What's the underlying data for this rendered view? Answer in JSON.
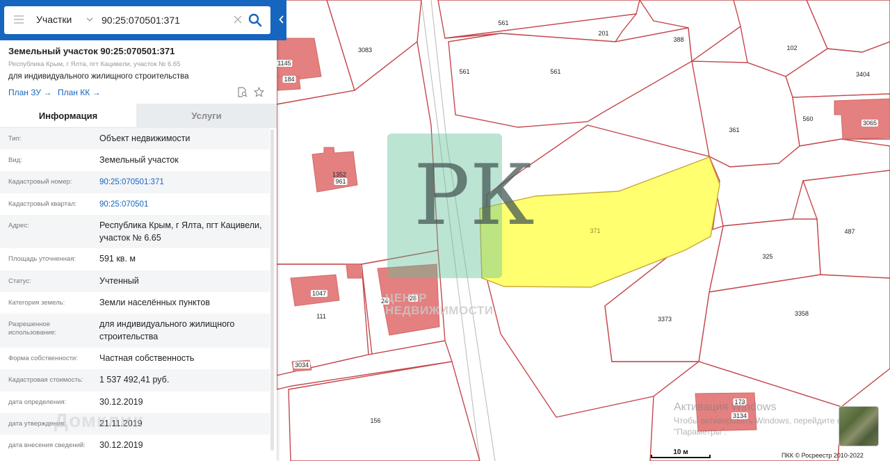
{
  "search": {
    "type_label": "Участки",
    "query": "90:25:070501:371"
  },
  "parcel": {
    "title": "Земельный участок 90:25:070501:371",
    "address": "Республика Крым, г Ялта, пгт Кацивели, участок № 6.65",
    "usage": "для индивидуального жилищного строительства",
    "links": [
      {
        "label": "План ЗУ →"
      },
      {
        "label": "План КК →"
      }
    ]
  },
  "tabs": [
    {
      "label": "Информация",
      "active": true
    },
    {
      "label": "Услуги",
      "active": false
    }
  ],
  "info_rows": [
    {
      "label": "Тип:",
      "value": "Объект недвижимости"
    },
    {
      "label": "Вид:",
      "value": "Земельный участок"
    },
    {
      "label": "Кадастровый номер:",
      "value": "90:25:070501:371",
      "link": true
    },
    {
      "label": "Кадастровый квартал:",
      "value": "90:25:070501",
      "link": true
    },
    {
      "label": "Адрес:",
      "value": "Республика Крым, г Ялта, пгт Кацивели, участок № 6.65"
    },
    {
      "label": "Площадь уточненная:",
      "value": "591 кв. м"
    },
    {
      "label": "Статус:",
      "value": "Учтенный"
    },
    {
      "label": "Категория земель:",
      "value": "Земли населённых пунктов"
    },
    {
      "label": "Разрешенное использование:",
      "value": "для индивидуального жилищного строительства"
    },
    {
      "label": "Форма собственности:",
      "value": "Частная собственность"
    },
    {
      "label": "Кадастровая стоимость:",
      "value": "1 537 492,41 руб."
    },
    {
      "label": "дата определения:",
      "value": "30.12.2019"
    },
    {
      "label": "дата утверждения:",
      "value": "21.11.2019"
    },
    {
      "label": "дата внесения сведений:",
      "value": "30.12.2019"
    }
  ],
  "map": {
    "parcel_labels": [
      "3083",
      "1145",
      "184",
      "561",
      "201",
      "388",
      "102",
      "3404",
      "561",
      "561",
      "361",
      "560",
      "3065",
      "1352",
      "961",
      "371",
      "487",
      "325",
      "1047",
      "111",
      "24",
      "28",
      "3373",
      "3358",
      "3034",
      "156",
      "173",
      "3134"
    ],
    "watermark_text_1": "ЦЕНТР",
    "watermark_text_2": "НЕДВИЖИМОСТИ",
    "watermark_glyph": "РК",
    "windows_title": "Активация Windows",
    "windows_line1": "Чтобы активировать Windows, перейдите в раздел",
    "windows_line2": "\"Параметры\".",
    "scale_label": "10 м",
    "copyright": "ПКК © Росреестр 2010-2022",
    "domclick": "Домклик",
    "selected_color": "#ffff70",
    "parcel_border_color": "#c4484c",
    "building_color": "#e48080"
  },
  "colors": {
    "brand": "#1665bf",
    "link": "#1665bf"
  }
}
